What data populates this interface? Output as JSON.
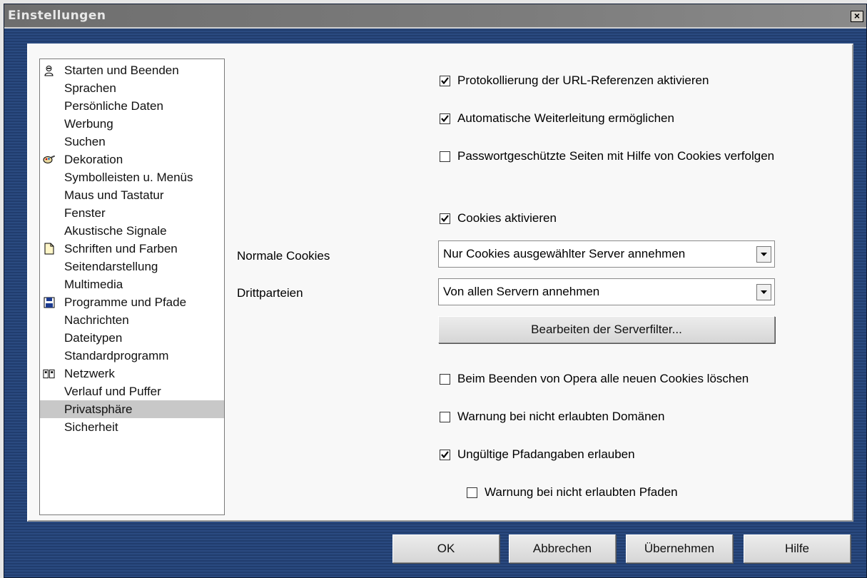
{
  "window": {
    "title": "Einstellungen",
    "close_glyph": "×"
  },
  "sidebar": {
    "items": [
      {
        "label": "Starten und Beenden",
        "icon": "person-icon"
      },
      {
        "label": "Sprachen"
      },
      {
        "label": "Persönliche Daten"
      },
      {
        "label": "Werbung"
      },
      {
        "label": "Suchen"
      },
      {
        "label": "Dekoration",
        "icon": "paint-icon"
      },
      {
        "label": "Symbolleisten u. Menüs"
      },
      {
        "label": "Maus und Tastatur"
      },
      {
        "label": "Fenster"
      },
      {
        "label": "Akustische Signale"
      },
      {
        "label": "Schriften und Farben",
        "icon": "document-icon"
      },
      {
        "label": "Seitendarstellung"
      },
      {
        "label": "Multimedia"
      },
      {
        "label": "Programme und Pfade",
        "icon": "floppy-icon"
      },
      {
        "label": "Nachrichten"
      },
      {
        "label": "Dateitypen"
      },
      {
        "label": "Standardprogramm"
      },
      {
        "label": "Netzwerk",
        "icon": "network-icon"
      },
      {
        "label": "Verlauf und Puffer"
      },
      {
        "label": "Privatsphäre",
        "selected": true
      },
      {
        "label": "Sicherheit"
      }
    ]
  },
  "privacy": {
    "url_logging": {
      "label": "Protokollierung der URL-Referenzen aktivieren",
      "checked": true
    },
    "auto_redirect": {
      "label": "Automatische Weiterleitung ermöglichen",
      "checked": true
    },
    "track_password_pages": {
      "label": "Passwortgeschützte Seiten mit Hilfe von Cookies verfolgen",
      "checked": false
    },
    "enable_cookies": {
      "label": "Cookies aktivieren",
      "checked": true
    },
    "normal_cookies": {
      "label": "Normale Cookies",
      "value": "Nur Cookies ausgewählter Server annehmen"
    },
    "third_party": {
      "label": "Drittparteien",
      "value": "Von allen Servern annehmen"
    },
    "edit_filter_button": "Bearbeiten der Serverfilter...",
    "delete_on_exit": {
      "label": "Beim Beenden von Opera alle neuen Cookies löschen",
      "checked": false
    },
    "warn_domains": {
      "label": "Warnung bei nicht erlaubten Domänen",
      "checked": false
    },
    "allow_invalid_paths": {
      "label": "Ungültige Pfadangaben erlauben",
      "checked": true
    },
    "warn_paths": {
      "label": "Warnung bei nicht erlaubten Pfaden",
      "checked": false
    }
  },
  "buttons": {
    "ok": "OK",
    "cancel": "Abbrechen",
    "apply": "Übernehmen",
    "help": "Hilfe"
  }
}
